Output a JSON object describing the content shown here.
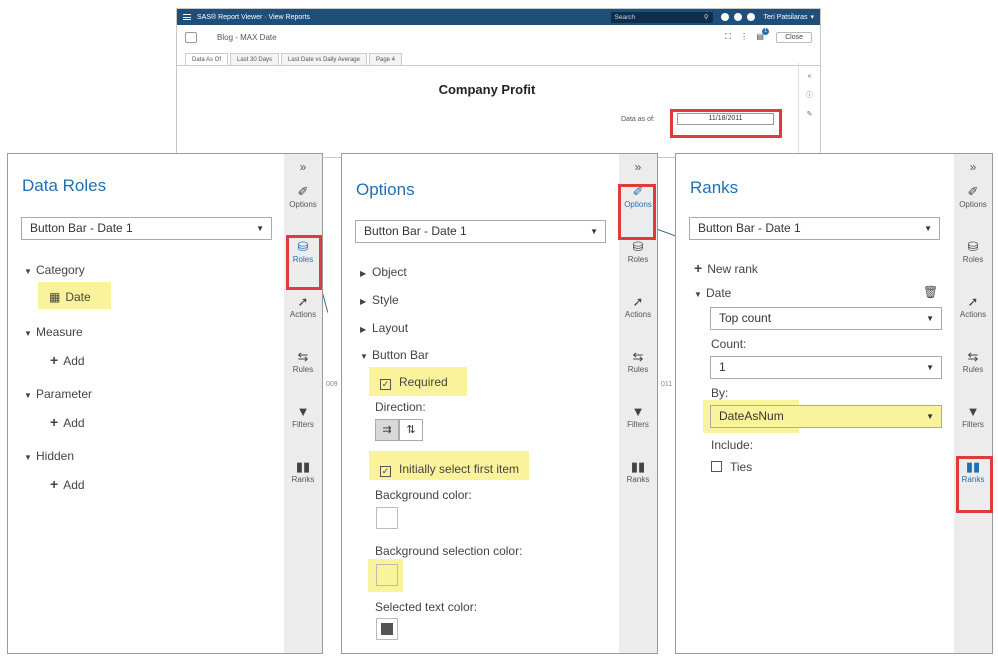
{
  "viewer": {
    "app_title": "SAS® Report Viewer · View Reports",
    "search_placeholder": "Search",
    "user": "Teri Patsilaras",
    "user_caret": "▾",
    "report_name": "Blog - MAX Date",
    "close_label": "Close",
    "notification_count": "1",
    "tabs": [
      "Data As Of",
      "Last 30 Days",
      "Last Date vs Daily Average",
      "Page 4"
    ],
    "report_title": "Company Profit",
    "data_asof_label": "Data as of:",
    "data_asof_value": "11/18/2011",
    "ghost_left": "009",
    "ghost_right": "011"
  },
  "rail_left": {
    "collapse": "»",
    "items": [
      "Options",
      "Roles",
      "Actions",
      "Rules",
      "Filters",
      "Ranks"
    ]
  },
  "rail_mid": {
    "collapse": "»",
    "items": [
      "Options",
      "Roles",
      "Actions",
      "Rules",
      "Filters",
      "Ranks"
    ]
  },
  "rail_right": {
    "collapse": "»",
    "items": [
      "Options",
      "Roles",
      "Actions",
      "Rules",
      "Filters",
      "Ranks"
    ]
  },
  "data_roles": {
    "title": "Data Roles",
    "object": "Button Bar - Date 1",
    "category_label": "Category",
    "category_value": "Date",
    "measure_label": "Measure",
    "parameter_label": "Parameter",
    "hidden_label": "Hidden",
    "add_label": "Add"
  },
  "options": {
    "title": "Options",
    "object": "Button Bar - Date 1",
    "sections": [
      "Object",
      "Style",
      "Layout",
      "Button Bar"
    ],
    "required_label": "Required",
    "direction_label": "Direction:",
    "initially_select_label": "Initially select first item",
    "background_color_label": "Background color:",
    "background_selection_color_label": "Background selection color:",
    "selected_text_color_label": "Selected text color:"
  },
  "ranks": {
    "title": "Ranks",
    "object": "Button Bar - Date 1",
    "new_rank_label": "New rank",
    "rank_item_label": "Date",
    "rank_type": "Top count",
    "count_label": "Count:",
    "count_value": "1",
    "by_label": "By:",
    "by_value": "DateAsNum",
    "include_label": "Include:",
    "ties_label": "Ties"
  },
  "colors": {
    "accent": "#1f6fb2",
    "highlight": "#faf39b",
    "callout": "#e03a3a",
    "header": "#1f4e79"
  },
  "icons": {
    "options": "paintbrush-icon",
    "roles": "database-icon",
    "actions": "cursor-icon",
    "rules": "rules-icon",
    "filters": "funnel-icon",
    "ranks": "bar-chart-icon",
    "calendar": "calendar-icon",
    "trash": "trash-icon"
  }
}
